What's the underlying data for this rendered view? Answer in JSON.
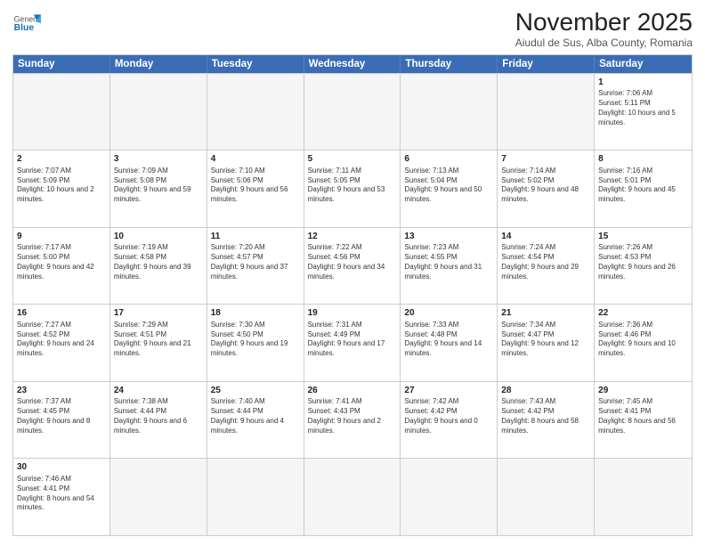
{
  "header": {
    "logo_general": "General",
    "logo_blue": "Blue",
    "month_title": "November 2025",
    "location": "Aiudul de Sus, Alba County, Romania"
  },
  "weekdays": [
    "Sunday",
    "Monday",
    "Tuesday",
    "Wednesday",
    "Thursday",
    "Friday",
    "Saturday"
  ],
  "weeks": [
    [
      {
        "day": "",
        "empty": true
      },
      {
        "day": "",
        "empty": true
      },
      {
        "day": "",
        "empty": true
      },
      {
        "day": "",
        "empty": true
      },
      {
        "day": "",
        "empty": true
      },
      {
        "day": "",
        "empty": true
      },
      {
        "day": "1",
        "rise": "7:06 AM",
        "set": "5:11 PM",
        "daylight": "10 hours and 5 minutes."
      }
    ],
    [
      {
        "day": "2",
        "rise": "7:07 AM",
        "set": "5:09 PM",
        "daylight": "10 hours and 2 minutes."
      },
      {
        "day": "3",
        "rise": "7:09 AM",
        "set": "5:08 PM",
        "daylight": "9 hours and 59 minutes."
      },
      {
        "day": "4",
        "rise": "7:10 AM",
        "set": "5:06 PM",
        "daylight": "9 hours and 56 minutes."
      },
      {
        "day": "5",
        "rise": "7:11 AM",
        "set": "5:05 PM",
        "daylight": "9 hours and 53 minutes."
      },
      {
        "day": "6",
        "rise": "7:13 AM",
        "set": "5:04 PM",
        "daylight": "9 hours and 50 minutes."
      },
      {
        "day": "7",
        "rise": "7:14 AM",
        "set": "5:02 PM",
        "daylight": "9 hours and 48 minutes."
      },
      {
        "day": "8",
        "rise": "7:16 AM",
        "set": "5:01 PM",
        "daylight": "9 hours and 45 minutes."
      }
    ],
    [
      {
        "day": "9",
        "rise": "7:17 AM",
        "set": "5:00 PM",
        "daylight": "9 hours and 42 minutes."
      },
      {
        "day": "10",
        "rise": "7:19 AM",
        "set": "4:58 PM",
        "daylight": "9 hours and 39 minutes."
      },
      {
        "day": "11",
        "rise": "7:20 AM",
        "set": "4:57 PM",
        "daylight": "9 hours and 37 minutes."
      },
      {
        "day": "12",
        "rise": "7:22 AM",
        "set": "4:56 PM",
        "daylight": "9 hours and 34 minutes."
      },
      {
        "day": "13",
        "rise": "7:23 AM",
        "set": "4:55 PM",
        "daylight": "9 hours and 31 minutes."
      },
      {
        "day": "14",
        "rise": "7:24 AM",
        "set": "4:54 PM",
        "daylight": "9 hours and 29 minutes."
      },
      {
        "day": "15",
        "rise": "7:26 AM",
        "set": "4:53 PM",
        "daylight": "9 hours and 26 minutes."
      }
    ],
    [
      {
        "day": "16",
        "rise": "7:27 AM",
        "set": "4:52 PM",
        "daylight": "9 hours and 24 minutes."
      },
      {
        "day": "17",
        "rise": "7:29 AM",
        "set": "4:51 PM",
        "daylight": "9 hours and 21 minutes."
      },
      {
        "day": "18",
        "rise": "7:30 AM",
        "set": "4:50 PM",
        "daylight": "9 hours and 19 minutes."
      },
      {
        "day": "19",
        "rise": "7:31 AM",
        "set": "4:49 PM",
        "daylight": "9 hours and 17 minutes."
      },
      {
        "day": "20",
        "rise": "7:33 AM",
        "set": "4:48 PM",
        "daylight": "9 hours and 14 minutes."
      },
      {
        "day": "21",
        "rise": "7:34 AM",
        "set": "4:47 PM",
        "daylight": "9 hours and 12 minutes."
      },
      {
        "day": "22",
        "rise": "7:36 AM",
        "set": "4:46 PM",
        "daylight": "9 hours and 10 minutes."
      }
    ],
    [
      {
        "day": "23",
        "rise": "7:37 AM",
        "set": "4:45 PM",
        "daylight": "9 hours and 8 minutes."
      },
      {
        "day": "24",
        "rise": "7:38 AM",
        "set": "4:44 PM",
        "daylight": "9 hours and 6 minutes."
      },
      {
        "day": "25",
        "rise": "7:40 AM",
        "set": "4:44 PM",
        "daylight": "9 hours and 4 minutes."
      },
      {
        "day": "26",
        "rise": "7:41 AM",
        "set": "4:43 PM",
        "daylight": "9 hours and 2 minutes."
      },
      {
        "day": "27",
        "rise": "7:42 AM",
        "set": "4:42 PM",
        "daylight": "9 hours and 0 minutes."
      },
      {
        "day": "28",
        "rise": "7:43 AM",
        "set": "4:42 PM",
        "daylight": "8 hours and 58 minutes."
      },
      {
        "day": "29",
        "rise": "7:45 AM",
        "set": "4:41 PM",
        "daylight": "8 hours and 56 minutes."
      }
    ],
    [
      {
        "day": "30",
        "rise": "7:46 AM",
        "set": "4:41 PM",
        "daylight": "8 hours and 54 minutes."
      },
      {
        "day": "",
        "empty": true
      },
      {
        "day": "",
        "empty": true
      },
      {
        "day": "",
        "empty": true
      },
      {
        "day": "",
        "empty": true
      },
      {
        "day": "",
        "empty": true
      },
      {
        "day": "",
        "empty": true
      }
    ]
  ]
}
